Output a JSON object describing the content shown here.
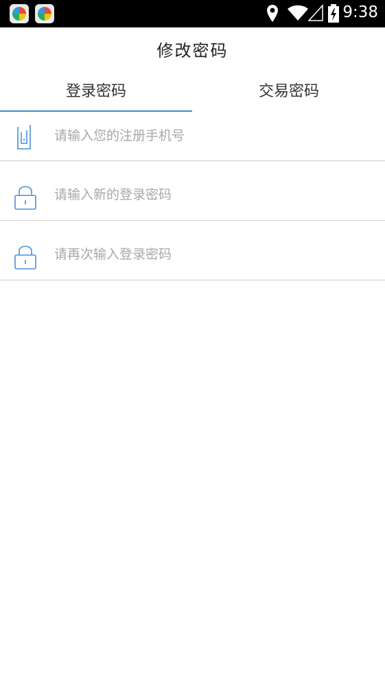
{
  "status_bar": {
    "time": "9:38",
    "icons": [
      "app-icon",
      "app-icon",
      "location-icon",
      "wifi-icon",
      "signal-icon",
      "battery-charging-icon"
    ]
  },
  "header": {
    "title": "修改密码"
  },
  "tabs": [
    {
      "label": "登录密码",
      "active": true
    },
    {
      "label": "交易密码",
      "active": false
    }
  ],
  "form": {
    "phone_placeholder": "请输入您的注册手机号",
    "new_password_placeholder": "请输入新的登录密码",
    "confirm_password_placeholder": "请再次输入登录密码"
  },
  "colors": {
    "accent": "#3c8ad4",
    "icon": "#4a8fd8",
    "placeholder": "#a8a8a8",
    "divider": "#cfcfcf"
  }
}
